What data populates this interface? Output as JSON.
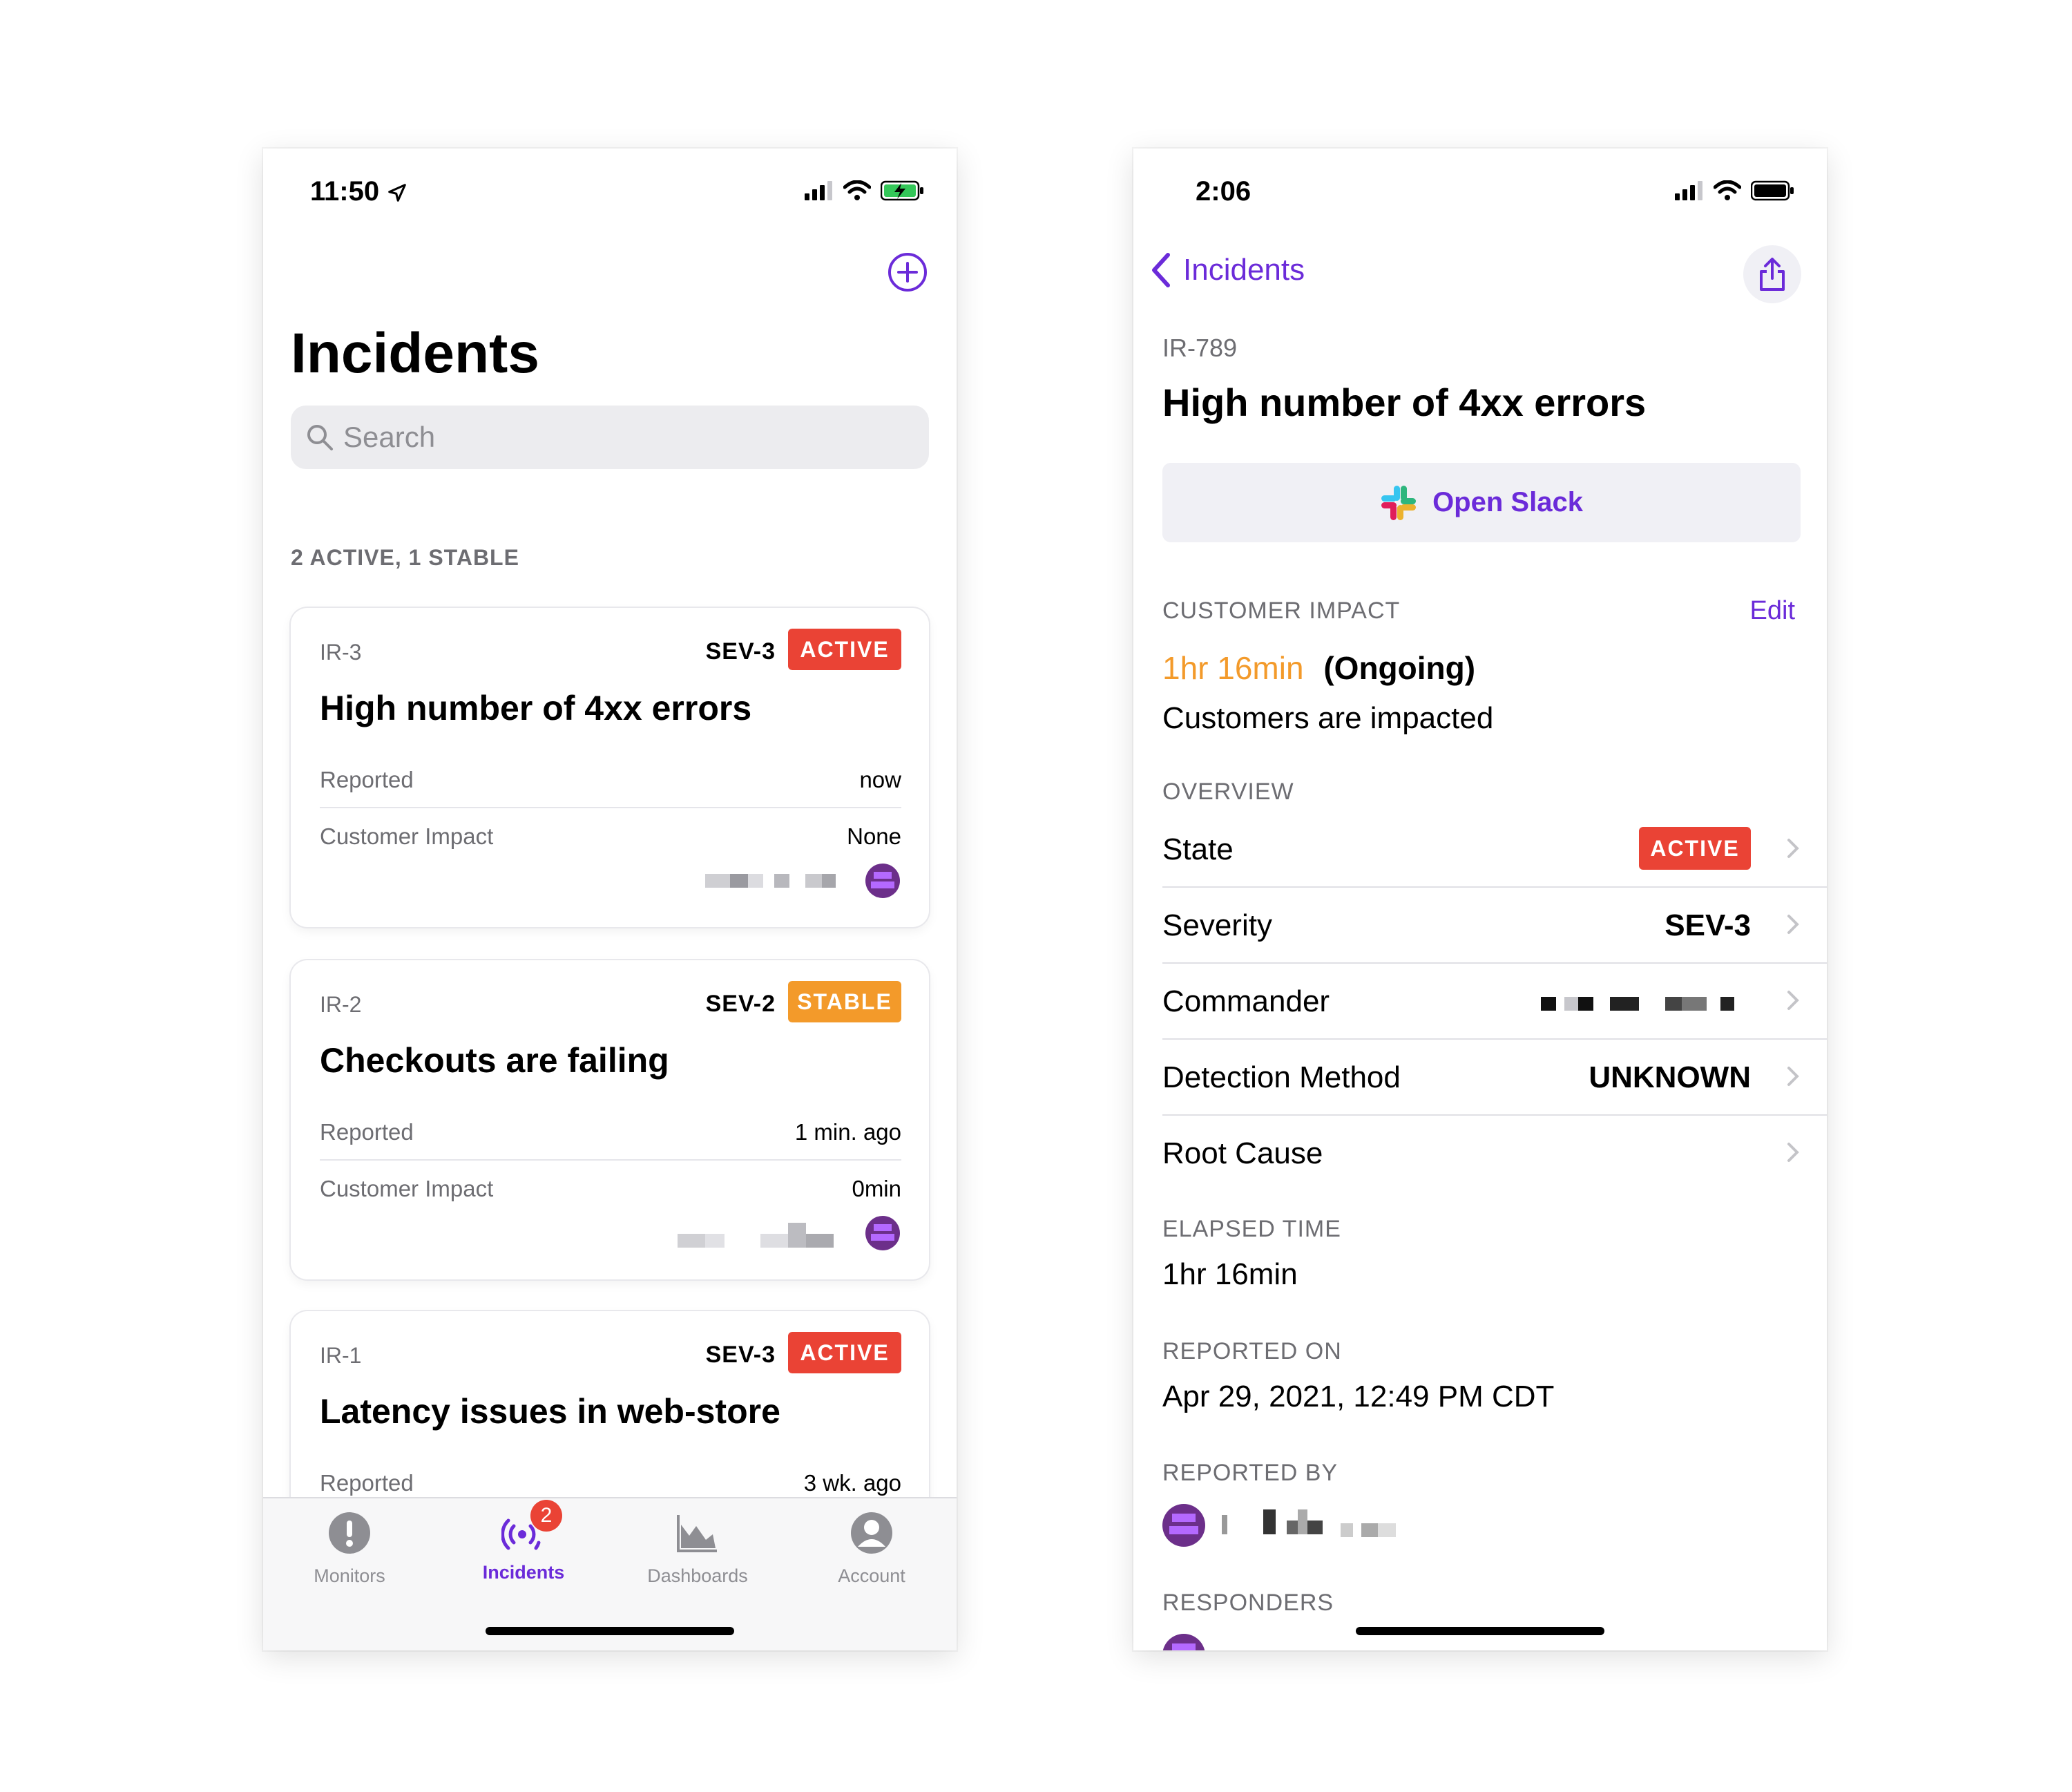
{
  "left_screen": {
    "status": {
      "time": "11:50"
    },
    "title": "Incidents",
    "search": {
      "placeholder": "Search"
    },
    "section_header": "2 ACTIVE, 1 STABLE",
    "cards": [
      {
        "id": "IR-3",
        "severity": "SEV-3",
        "status": "ACTIVE",
        "title": "High number of 4xx errors",
        "reported_label": "Reported",
        "reported_value": "now",
        "impact_label": "Customer Impact",
        "impact_value": "None"
      },
      {
        "id": "IR-2",
        "severity": "SEV-2",
        "status": "STABLE",
        "title": "Checkouts are failing",
        "reported_label": "Reported",
        "reported_value": "1 min. ago",
        "impact_label": "Customer Impact",
        "impact_value": "0min"
      },
      {
        "id": "IR-1",
        "severity": "SEV-3",
        "status": "ACTIVE",
        "title": "Latency issues in web-store",
        "reported_label": "Reported",
        "reported_value": "3 wk. ago"
      }
    ],
    "tabs": [
      {
        "label": "Monitors",
        "icon": "exclamation-circle-icon"
      },
      {
        "label": "Incidents",
        "icon": "incidents-radar-icon",
        "badge": "2"
      },
      {
        "label": "Dashboards",
        "icon": "area-chart-icon"
      },
      {
        "label": "Account",
        "icon": "person-circle-icon"
      }
    ],
    "selected_tab": "Incidents"
  },
  "right_screen": {
    "status": {
      "time": "2:06"
    },
    "nav": {
      "back_label": "Incidents"
    },
    "incident_id": "IR-789",
    "title": "High number of 4xx errors",
    "open_slack_label": "Open Slack",
    "customer_impact": {
      "header": "CUSTOMER IMPACT",
      "edit_label": "Edit",
      "duration": "1hr 16min",
      "state": "(Ongoing)",
      "description": "Customers are impacted"
    },
    "overview": {
      "header": "OVERVIEW",
      "rows": [
        {
          "label": "State",
          "value": "ACTIVE"
        },
        {
          "label": "Severity",
          "value": "SEV-3"
        },
        {
          "label": "Commander",
          "value": ""
        },
        {
          "label": "Detection Method",
          "value": "UNKNOWN"
        },
        {
          "label": "Root Cause",
          "value": ""
        }
      ]
    },
    "elapsed": {
      "header": "ELAPSED TIME",
      "value": "1hr 16min"
    },
    "reported_on": {
      "header": "REPORTED ON",
      "value": "Apr 29, 2021, 12:49 PM CDT"
    },
    "reported_by": {
      "header": "REPORTED BY"
    },
    "responders": {
      "header": "RESPONDERS"
    }
  },
  "colors": {
    "accent": "#6b2bd9",
    "active_red": "#ea4335",
    "stable_orange": "#f39a2a",
    "impact_orange": "#f39a2a"
  }
}
